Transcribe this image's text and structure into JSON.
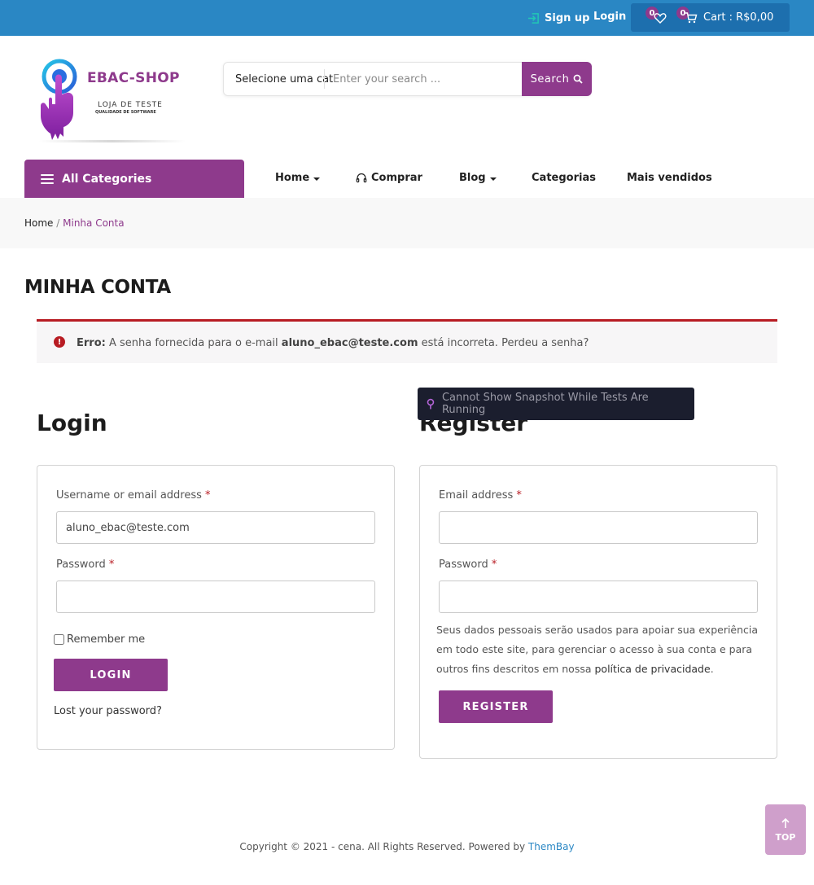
{
  "topbar": {
    "signup_label": "Sign up",
    "login_label": "Login",
    "wishlist_count": "0",
    "cart_count": "0",
    "cart_label": "Cart : R$0,00"
  },
  "logo": {
    "brand": "EBAC-SHOP",
    "tagline": "LOJA DE TESTE",
    "subtagline": "QUALIDADE DE SOFTWARE"
  },
  "search": {
    "category": "Selecione uma cat",
    "placeholder": "Enter your search ...",
    "button_label": "Search"
  },
  "nav": {
    "all_categories": "All Categories",
    "items": [
      {
        "label": "Home"
      },
      {
        "label": "Comprar"
      },
      {
        "label": "Blog"
      },
      {
        "label": "Categorias"
      },
      {
        "label": "Mais vendidos"
      }
    ]
  },
  "breadcrumb": {
    "home": "Home",
    "separator": "/",
    "current": "Minha Conta"
  },
  "page_title": "MINHA CONTA",
  "error": {
    "prefix": "Erro:",
    "text_before": "A senha fornecida para o e-mail",
    "email": "aluno_ebac@teste.com",
    "text_after": "está incorreta.",
    "lost_link": "Perdeu a senha?"
  },
  "tooltip": "Cannot Show Snapshot While Tests Are Running",
  "login": {
    "title": "Login",
    "username_label": "Username or email address",
    "username_value": "aluno_ebac@teste.com",
    "password_label": "Password",
    "required_mark": "*",
    "remember_label": "Remember me",
    "button_label": "LOGIN",
    "lost_password": "Lost your password?"
  },
  "register": {
    "title": "Register",
    "email_label": "Email address",
    "password_label": "Password",
    "required_mark": "*",
    "privacy_text": "Seus dados pessoais serão usados para apoiar sua experiência em todo este site, para gerenciar o acesso à sua conta e para outros fins descritos em nossa",
    "privacy_link": "política de privacidade",
    "privacy_end": ".",
    "button_label": "REGISTER"
  },
  "footer": {
    "copyright": "Copyright © 2021 - cena. All Rights Reserved. Powered by",
    "link": "ThemBay"
  },
  "totop_label": "TOP",
  "colors": {
    "topbar": "#2a87c4",
    "brand_purple": "#8e3a8c",
    "error_red": "#b81c23"
  }
}
